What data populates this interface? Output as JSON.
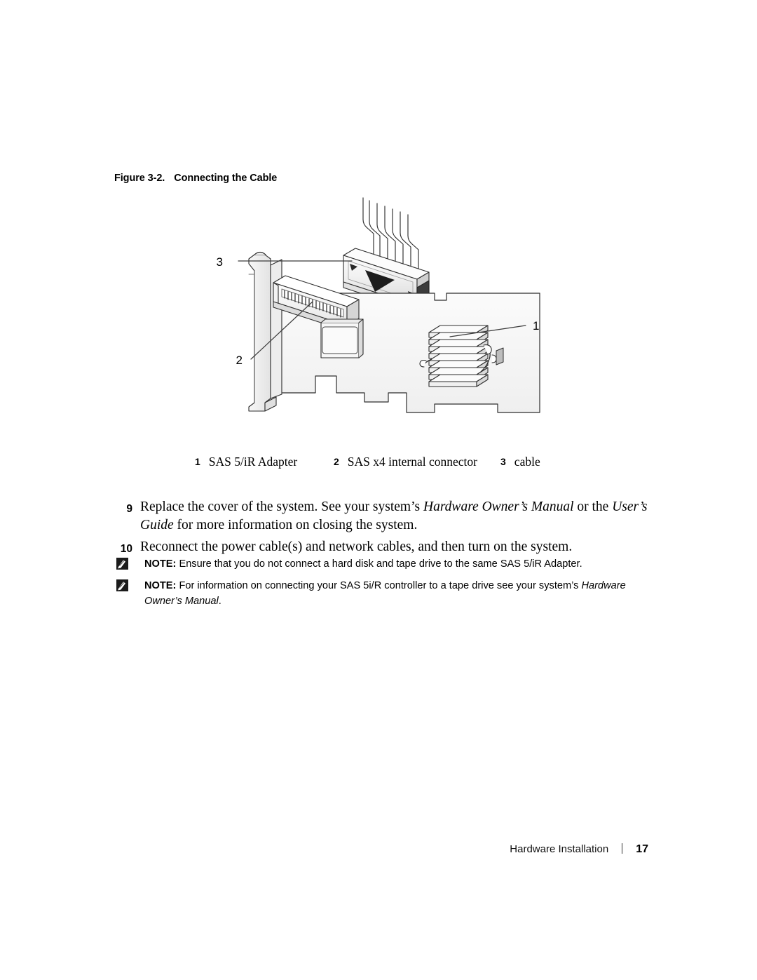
{
  "figure": {
    "number": "Figure 3-2.",
    "title": "Connecting the Cable",
    "arrow_color": "#29abe2",
    "line_color": "#3a3a3a",
    "legend": [
      {
        "num": "1",
        "label": "SAS 5/iR Adapter"
      },
      {
        "num": "2",
        "label": "SAS x4 internal connector"
      },
      {
        "num": "3",
        "label": "cable"
      }
    ],
    "callouts": [
      {
        "num": "1",
        "target": "sas-5ir-adapter-board"
      },
      {
        "num": "2",
        "target": "sas-x4-internal-connector"
      },
      {
        "num": "3",
        "target": "cable"
      }
    ]
  },
  "steps": [
    {
      "num": "9",
      "text_parts": [
        {
          "text": "Replace the cover of the system. See your system’s ",
          "italic": false
        },
        {
          "text": "Hardware Owner’s Manual",
          "italic": true
        },
        {
          "text": " or the ",
          "italic": false
        },
        {
          "text": "User’s Guide",
          "italic": true
        },
        {
          "text": " for more information on closing the system.",
          "italic": false
        }
      ]
    },
    {
      "num": "10",
      "text_parts": [
        {
          "text": "Reconnect the power cable(s) and network cables, and then turn on the system.",
          "italic": false
        }
      ]
    }
  ],
  "notes": [
    {
      "label": "NOTE:",
      "icon": "note-pencil-icon",
      "text_parts": [
        {
          "text": " Ensure that you do not connect a hard disk and tape drive to the same SAS 5/iR Adapter.",
          "italic": false
        }
      ]
    },
    {
      "label": "NOTE:",
      "icon": "note-pencil-icon",
      "text_parts": [
        {
          "text": " For information on connecting your SAS 5i/R controller to a tape drive see your system’s ",
          "italic": false
        },
        {
          "text": "Hardware Owner’s Manual",
          "italic": true
        },
        {
          "text": ".",
          "italic": false
        }
      ]
    }
  ],
  "footer": {
    "title": "Hardware Installation",
    "separator": "|",
    "page": "17"
  }
}
